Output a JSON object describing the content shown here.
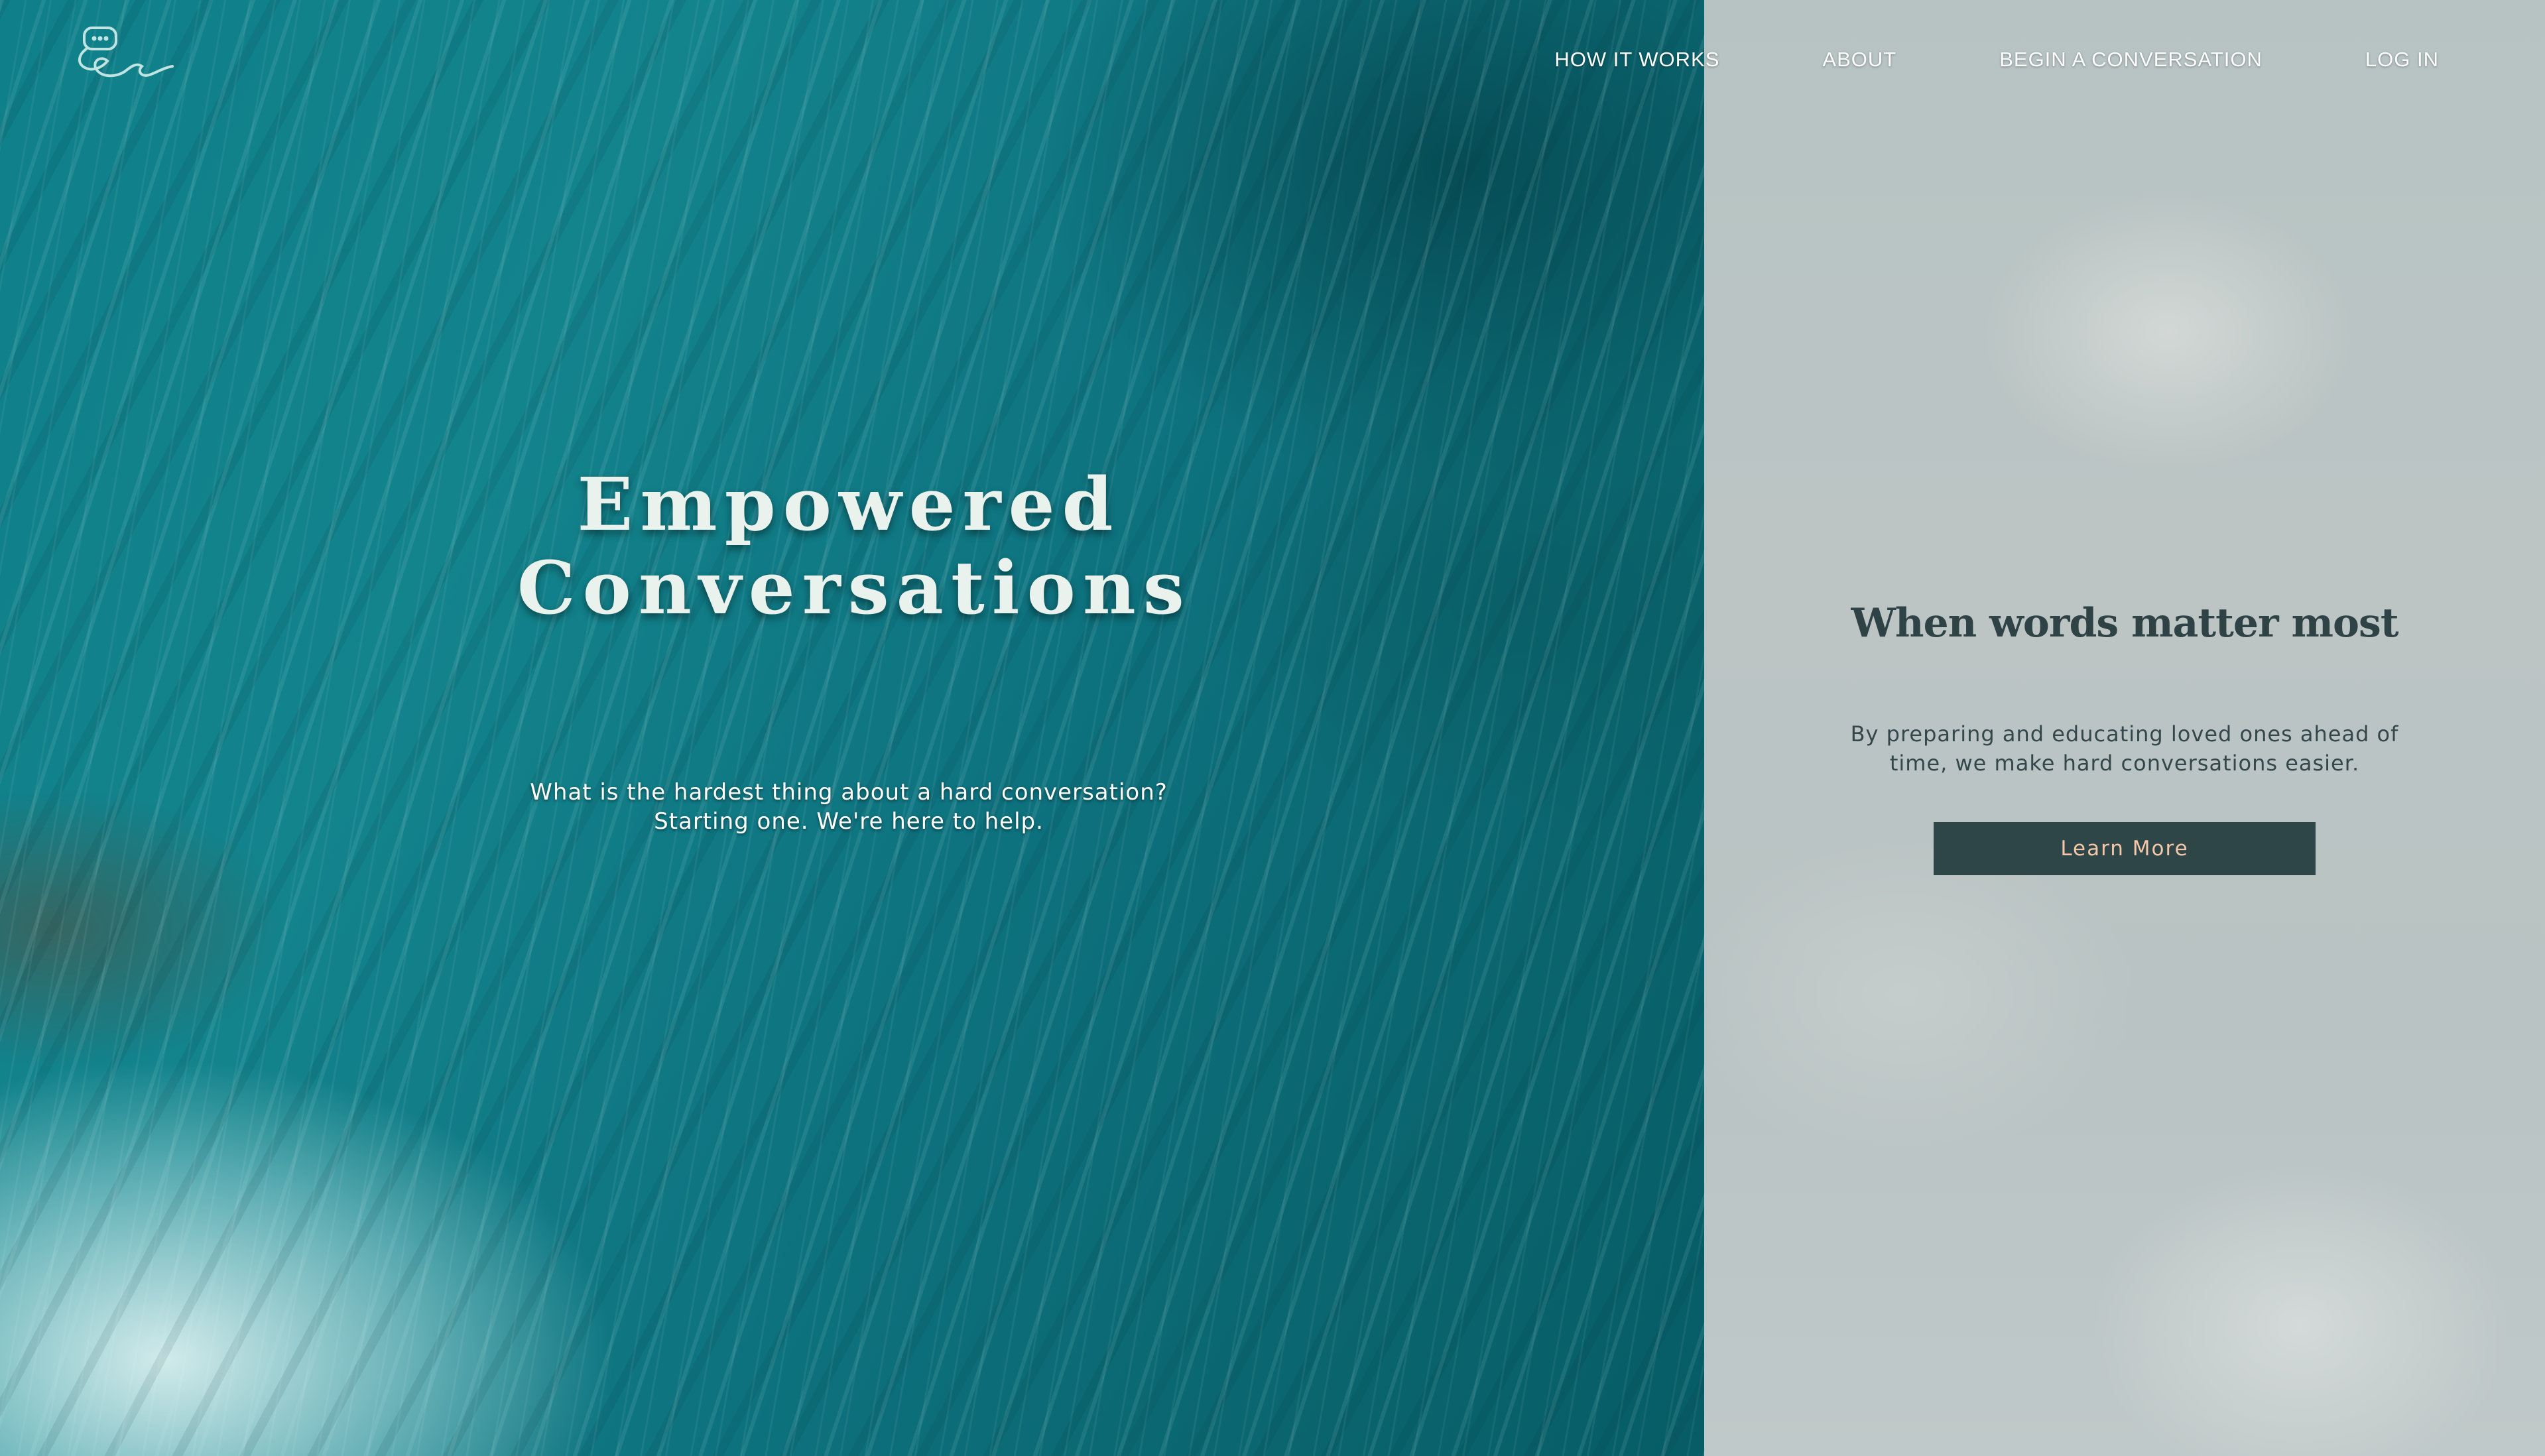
{
  "nav": {
    "items": [
      {
        "label": "HOW IT WORKS"
      },
      {
        "label": "ABOUT"
      },
      {
        "label": "BEGIN A CONVERSATION"
      },
      {
        "label": "LOG IN"
      }
    ]
  },
  "logo": {
    "icon": "chat-bubble-ec-logo-icon"
  },
  "hero": {
    "title_line1": "Empowered",
    "title_line2": "Conversations",
    "subtitle_line1": "What is the hardest thing about a hard conversation?",
    "subtitle_line2": "Starting one. We're here to help."
  },
  "panel": {
    "title": "When words matter most",
    "text_line1": "By preparing and educating loved ones ahead of",
    "text_line2": "time, we make hard conversations easier.",
    "button_label": "Learn More"
  },
  "colors": {
    "ocean": "#0f7f89",
    "panel_bg": "#b9c3c3",
    "button_bg": "#2f4649",
    "button_text": "#f3c7a8",
    "panel_heading": "#2f4346"
  }
}
